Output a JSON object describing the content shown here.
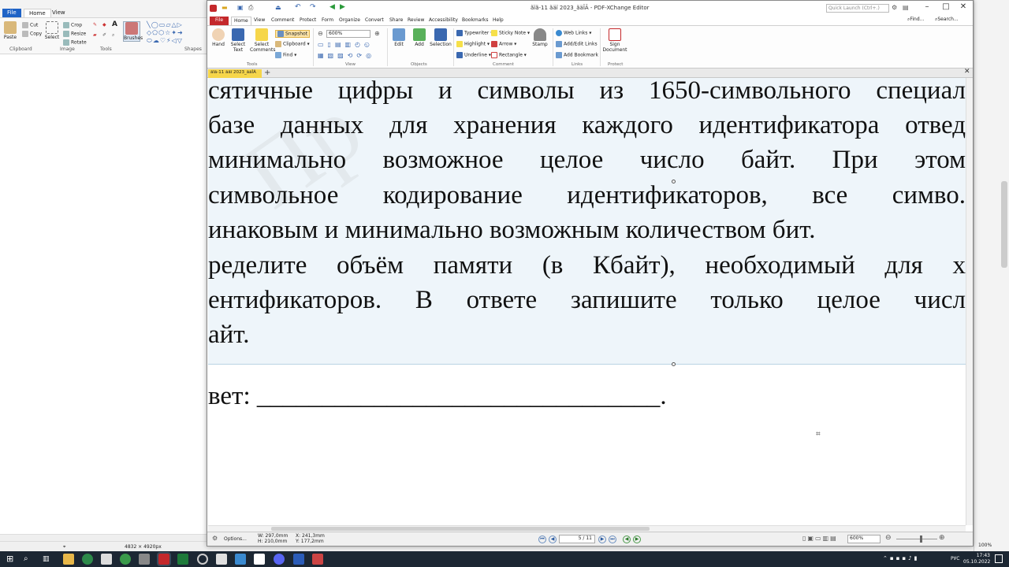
{
  "paint": {
    "tabs": [
      "File",
      "Home",
      "View"
    ],
    "buttons": {
      "paste": "Paste",
      "cut": "Cut",
      "copy": "Copy",
      "crop": "Crop",
      "resize": "Resize",
      "rotate": "Rotate",
      "select": "Select",
      "brushes": "Brushes"
    },
    "groups": [
      "Clipboard",
      "Image",
      "Tools",
      "Shapes"
    ],
    "status_size": "4832 × 4920px"
  },
  "pdf": {
    "title": "ãïã-11 ãäï 2023_ãäÎÃ - PDF-XChange Editor",
    "quick_launch": "Quick Launch (Ctrl+.)",
    "find": "Find...",
    "search": "Search...",
    "menu": [
      "File",
      "Home",
      "View",
      "Comment",
      "Protect",
      "Form",
      "Organize",
      "Convert",
      "Share",
      "Review",
      "Accessibility",
      "Bookmarks",
      "Help"
    ],
    "ribbon": {
      "hand": "Hand",
      "select_text": "Select Text",
      "select_comments": "Select Comments",
      "snapshot": "Snapshot",
      "clipboard": "Clipboard",
      "find": "Find",
      "zoom": "600%",
      "edit": "Edit",
      "add": "Add",
      "selection": "Selection",
      "typewriter": "Typewriter",
      "sticky_note": "Sticky Note",
      "highlight": "Highlight",
      "arrow": "Arrow",
      "underline": "Underline",
      "rectangle": "Rectangle",
      "stamp": "Stamp",
      "web_links": "Web Links",
      "add_edit_links": "Add/Edit Links",
      "add_bookmark": "Add Bookmark",
      "sign_document": "Sign Document",
      "groups": [
        "Tools",
        "View",
        "Objects",
        "Comment",
        "Links",
        "Protect"
      ]
    },
    "doc_tab": "ãïã-11 ãäï 2023_ãäÎÃ",
    "document_lines": [
      "сятичные цифры и символы из 1650-символьного специал",
      "базе данных для хранения каждого идентификатора отвед",
      "минимально возможное целое число байт. При этом",
      "символьное кодирование идентификаторов, все симво.",
      "инаковым и минимально возможным количеством бит.",
      "ределите объём памяти (в Кбайт), необходимый для х",
      "ентификаторов. В ответе запишите только целое числ",
      "айт."
    ],
    "answer_line": "вет: _______________________________.",
    "status": {
      "options": "Options...",
      "width": "W: 297,0mm",
      "height": "H: 210,0mm",
      "x": "X: 241,3mm",
      "y": "Y: 177,2mm",
      "page": "5 / 11",
      "zoom": "600%"
    }
  },
  "taskbar": {
    "lang": "РУС",
    "time": "17:43",
    "date": "05.10.2022",
    "zoom_pct": "100%"
  }
}
